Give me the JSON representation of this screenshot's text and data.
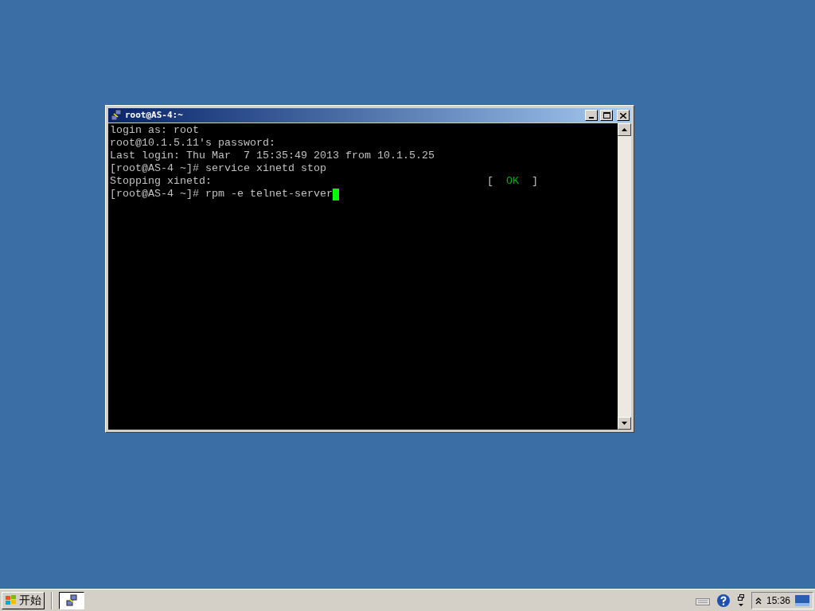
{
  "window": {
    "title": "root@AS-4:~"
  },
  "terminal": {
    "lines": [
      {
        "text": "login as: root",
        "cursor": false
      },
      {
        "text": "root@10.1.5.11's password:",
        "cursor": false
      },
      {
        "text": "Last login: Thu Mar  7 15:35:49 2013 from 10.1.5.25",
        "cursor": false
      },
      {
        "text": "[root@AS-4 ~]# service xinetd stop",
        "cursor": false
      },
      {
        "text": "Stopping xinetd:",
        "cursor": false,
        "status": {
          "open": "[",
          "label": "OK",
          "close": "]"
        }
      },
      {
        "text": "[root@AS-4 ~]# rpm -e telnet-server",
        "cursor": true
      }
    ]
  },
  "taskbar": {
    "start_label": "开始",
    "clock": "15:36"
  }
}
